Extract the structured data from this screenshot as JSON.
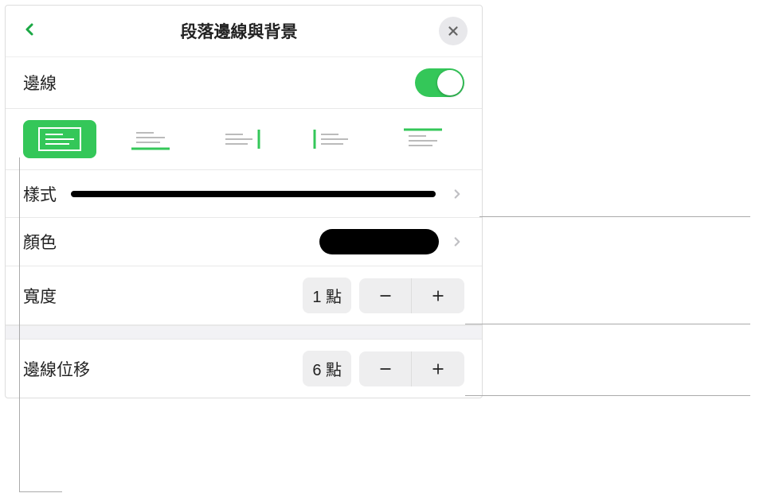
{
  "header": {
    "title": "段落邊線與背景"
  },
  "border_toggle": {
    "label": "邊線",
    "enabled": true
  },
  "style_row": {
    "label": "樣式"
  },
  "color_row": {
    "label": "顏色",
    "value": "#000000"
  },
  "width_row": {
    "label": "寬度",
    "value": "1 點"
  },
  "offset_row": {
    "label": "邊線位移",
    "value": "6 點"
  },
  "side_tabs": [
    {
      "name": "all-sides",
      "active": true
    },
    {
      "name": "bottom-side",
      "active": false
    },
    {
      "name": "right-side",
      "active": false
    },
    {
      "name": "left-side",
      "active": false
    },
    {
      "name": "top-side",
      "active": false
    }
  ]
}
